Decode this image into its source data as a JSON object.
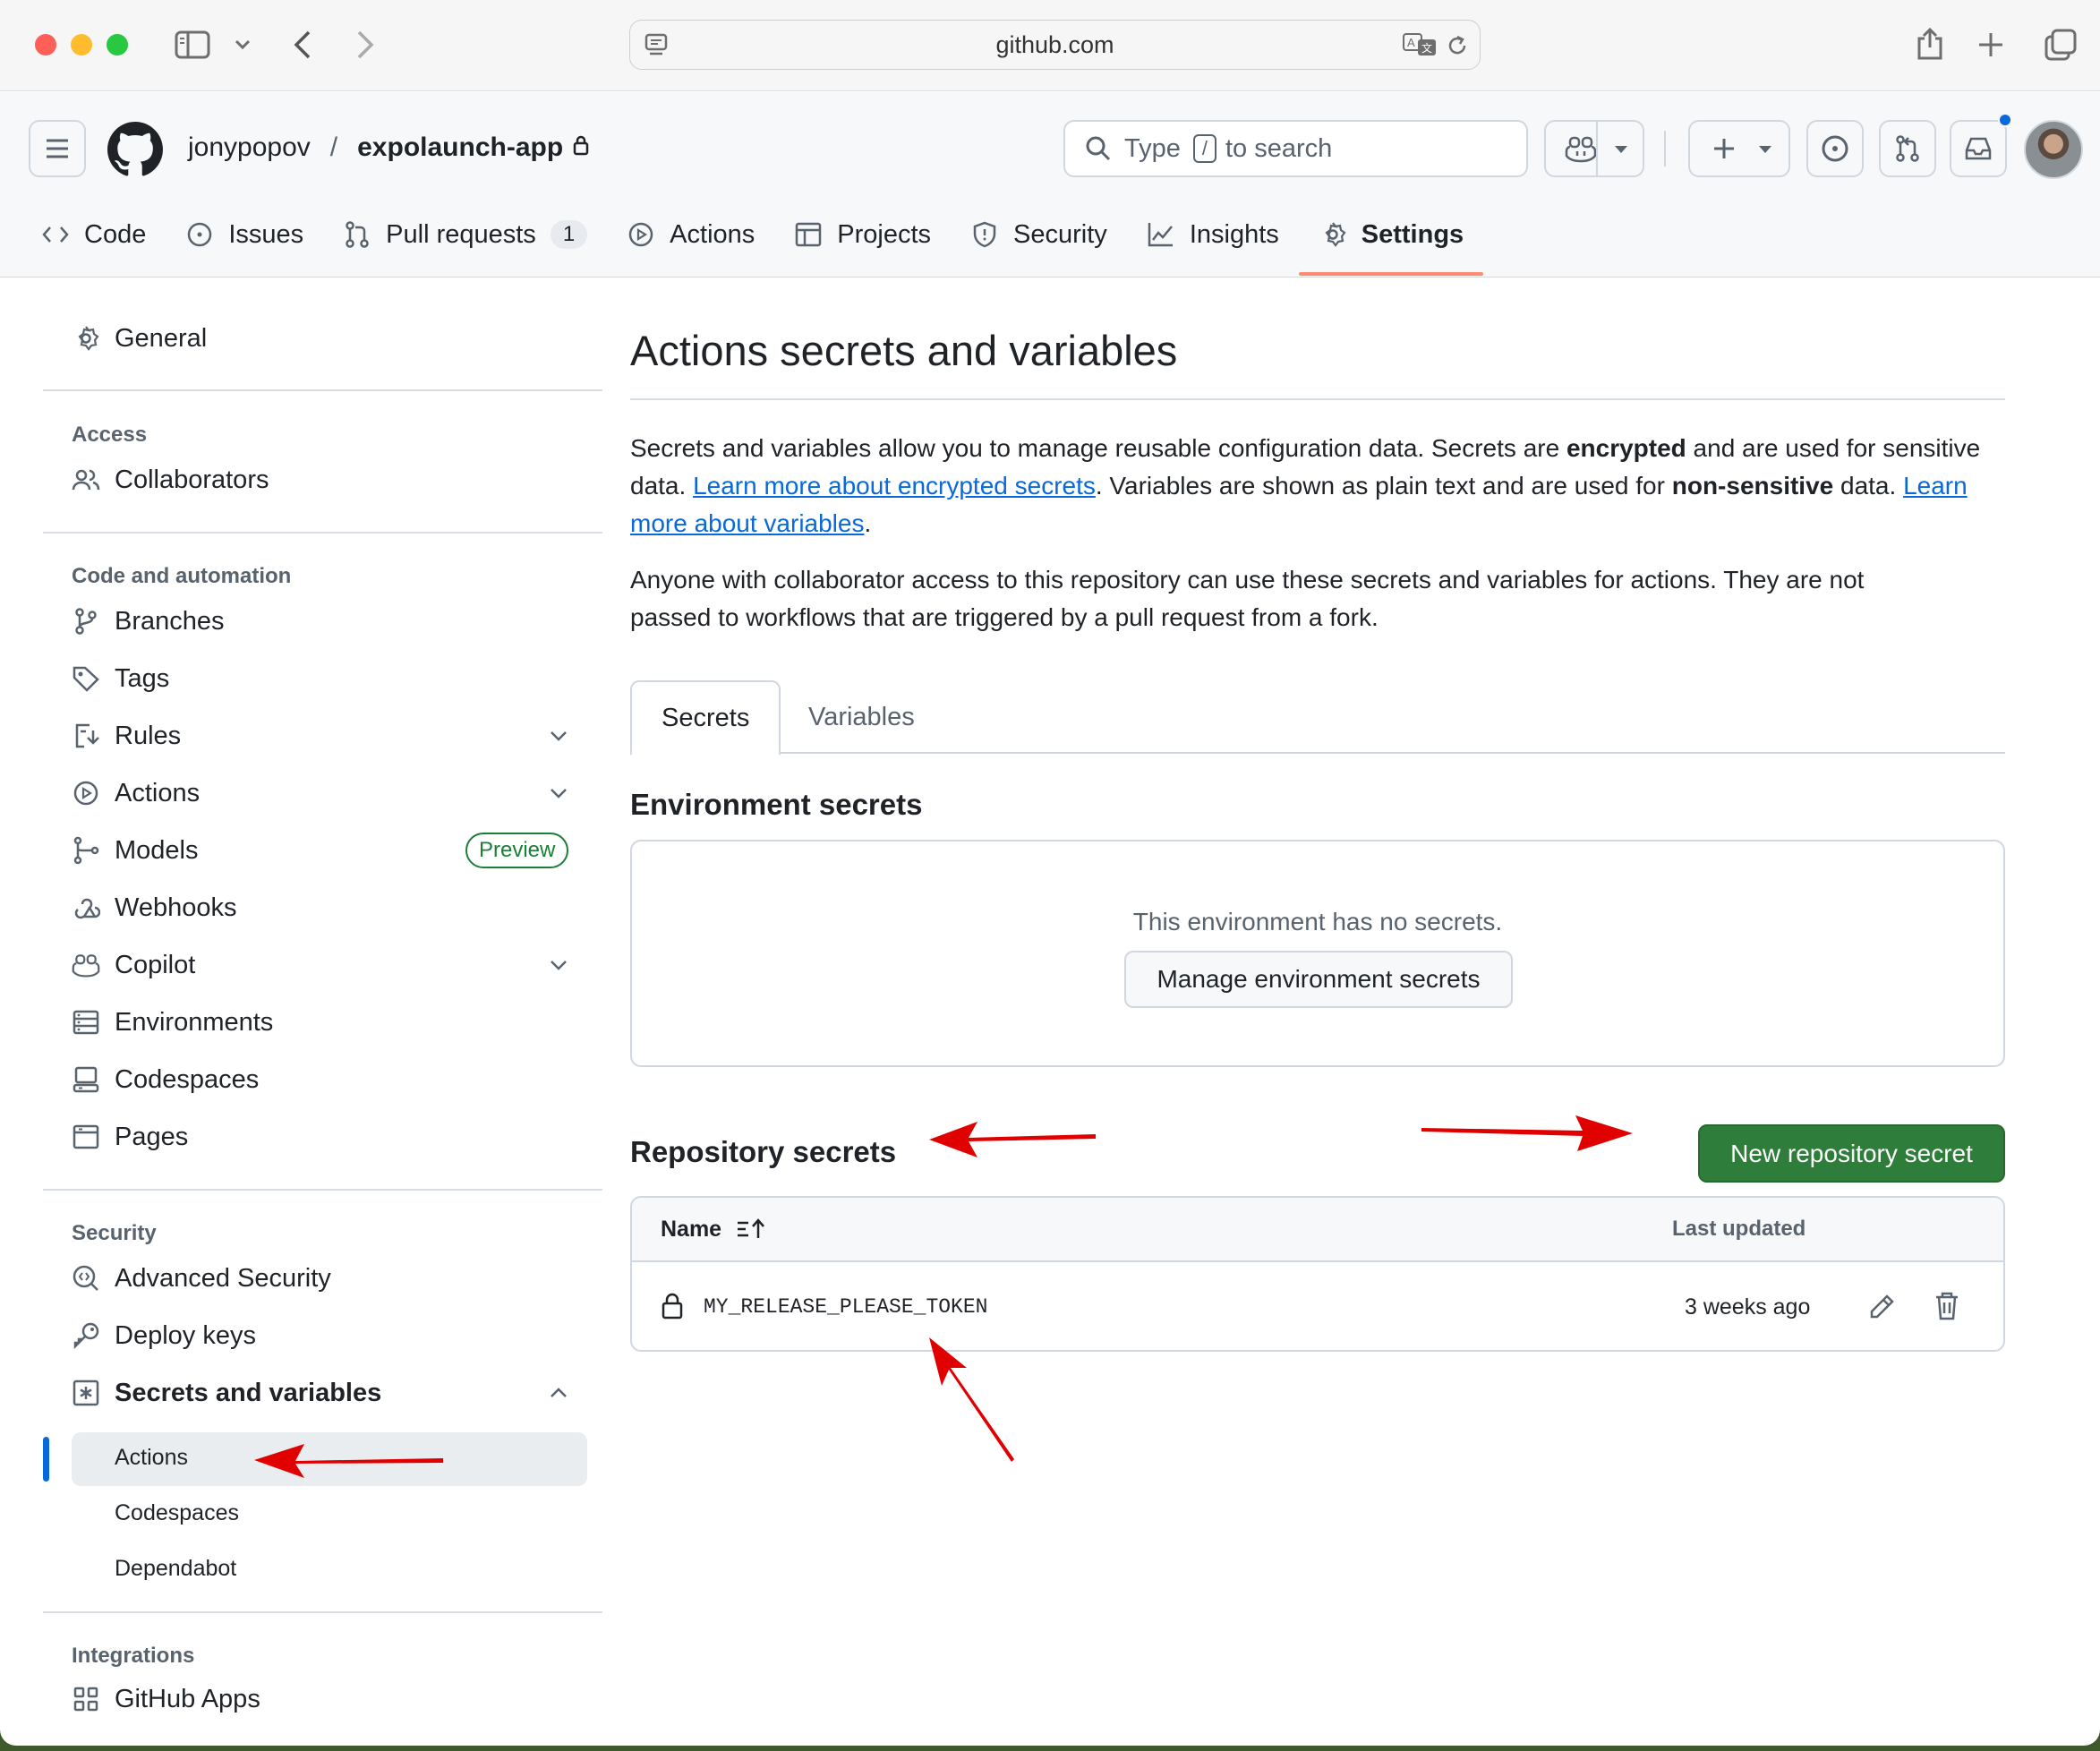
{
  "browser": {
    "url": "github.com",
    "traffic_colors": [
      "#fe5f57",
      "#febc2e",
      "#28c840"
    ]
  },
  "header": {
    "owner": "jonypopov",
    "separator": "/",
    "repo": "expolaunch-app",
    "search": {
      "prefix": "Type",
      "key": "/",
      "suffix": "to search"
    }
  },
  "repo_nav": {
    "code": "Code",
    "issues": "Issues",
    "pull_requests": "Pull requests",
    "pull_requests_count": "1",
    "actions": "Actions",
    "projects": "Projects",
    "security": "Security",
    "insights": "Insights",
    "settings": "Settings"
  },
  "sidebar": {
    "general": "General",
    "access_heading": "Access",
    "collaborators": "Collaborators",
    "code_heading": "Code and automation",
    "branches": "Branches",
    "tags": "Tags",
    "rules": "Rules",
    "actions": "Actions",
    "models": "Models",
    "models_badge": "Preview",
    "webhooks": "Webhooks",
    "copilot": "Copilot",
    "environments": "Environments",
    "codespaces": "Codespaces",
    "pages": "Pages",
    "security_heading": "Security",
    "advanced_security": "Advanced Security",
    "deploy_keys": "Deploy keys",
    "secrets_and_variables": "Secrets and variables",
    "sub_actions": "Actions",
    "sub_codespaces": "Codespaces",
    "sub_dependabot": "Dependabot",
    "integrations_heading": "Integrations",
    "github_apps": "GitHub Apps"
  },
  "main": {
    "title": "Actions secrets and variables",
    "intro": {
      "t1": "Secrets and variables allow you to manage reusable configuration data. Secrets are ",
      "b1": "encrypted",
      "t2": " and are used for sensitive data. ",
      "link1": "Learn more about encrypted secrets",
      "t3": ". Variables are shown as plain text and are used for ",
      "b2": "non-sensitive",
      "t4": " data. ",
      "link2": "Learn more about variables",
      "t5": "."
    },
    "note": "Anyone with collaborator access to this repository can use these secrets and variables for actions. They are not passed to workflows that are triggered by a pull request from a fork.",
    "tabs": [
      "Secrets",
      "Variables"
    ],
    "env_heading": "Environment secrets",
    "env_empty": "This environment has no secrets.",
    "manage_env_button": "Manage environment secrets",
    "repo_heading": "Repository secrets",
    "new_secret_button": "New repository secret",
    "table": {
      "col_name": "Name",
      "col_updated": "Last updated",
      "rows": [
        {
          "name": "MY_RELEASE_PLEASE_TOKEN",
          "updated": "3 weeks ago"
        }
      ]
    }
  },
  "colors": {
    "link": "#0969da",
    "primary_button": "#2f7d3a",
    "annotation_arrow": "#e00000",
    "selected_tab_underline": "#fd8c73",
    "sidebar_active_bar": "#0969da"
  }
}
